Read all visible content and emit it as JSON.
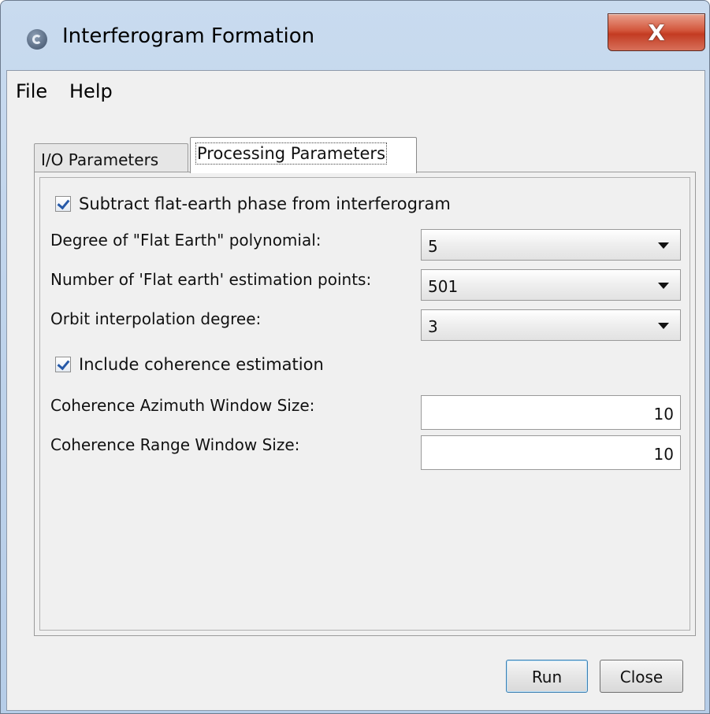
{
  "window": {
    "title": "Interferogram Formation",
    "close_glyph": "X"
  },
  "menu": {
    "items": [
      "File",
      "Help"
    ]
  },
  "tabs": [
    "I/O Parameters",
    "Processing Parameters"
  ],
  "active_tab": "Processing Parameters",
  "form": {
    "subtract_flat_earth": {
      "label": "Subtract flat-earth phase from interferogram",
      "checked": true
    },
    "degree_polynomial": {
      "label": "Degree of \"Flat Earth\" polynomial:",
      "value": "5"
    },
    "estimation_points": {
      "label": "Number of 'Flat earth' estimation points:",
      "value": "501"
    },
    "orbit_degree": {
      "label": "Orbit interpolation degree:",
      "value": "3"
    },
    "include_coherence": {
      "label": "Include coherence estimation",
      "checked": true
    },
    "coh_azimuth": {
      "label": "Coherence Azimuth Window Size:",
      "value": "10"
    },
    "coh_range": {
      "label": "Coherence Range Window Size:",
      "value": "10"
    }
  },
  "buttons": {
    "run": "Run",
    "close": "Close"
  },
  "icons": {
    "app": "esa-app-icon",
    "close": "close-icon",
    "dropdown": "chevron-down-icon",
    "check": "checkmark-icon"
  }
}
